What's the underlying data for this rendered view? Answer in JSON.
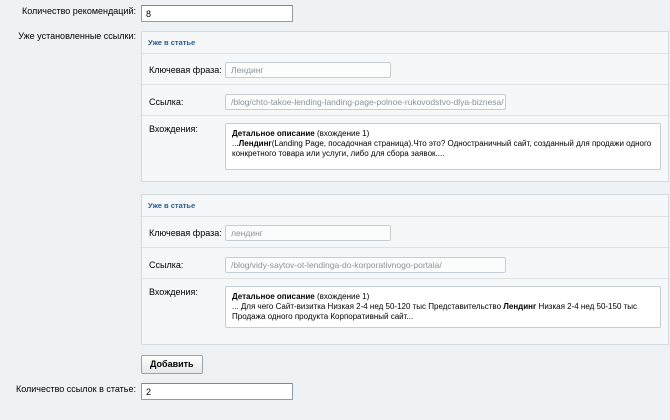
{
  "recommendations": {
    "label": "Количество рекомендаций:",
    "value": "8"
  },
  "installed_links": {
    "label": "Уже установленные ссылки:",
    "items": [
      {
        "title": "Уже в статье",
        "keyword_label": "Ключевая фраза:",
        "keyword": "Лендинг",
        "link_label": "Ссылка:",
        "link": "/blog/chto-takoe-lending-landing-page-polnoe-rukovodstvo-dlya-biznesa/",
        "occurrences_label": "Вхождения:",
        "occurrence_heading": "Детальное описание",
        "occurrence_count": "(вхождение 1)",
        "snippet_prefix": "...",
        "snippet_bold": "Лендинг",
        "snippet_rest": "(Landing Page, посадочная страница).Что это?  Одностраничный сайт, созданный для продажи одного конкретного товара или услуги, либо для сбора заявок...."
      },
      {
        "title": "Уже в статье",
        "keyword_label": "Ключевая фраза:",
        "keyword": "лендинг",
        "link_label": "Ссылка:",
        "link": "/blog/vidy-saytov-ot-lendinga-do-korporativnogo-portala/",
        "occurrences_label": "Вхождения:",
        "occurrence_heading": "Детальное описание",
        "occurrence_count": "(вхождение 1)",
        "snippet_prefix": "... Для чего  Сайт-визитка  Низкая  2-4 нед  50-120 тыс  Представительство ",
        "snippet_bold": "Лендинг",
        "snippet_rest": " Низкая  2-4 нед  50-150 тыс  Продажа одного продукта  Корпоративный сайт..."
      }
    ]
  },
  "add_button": {
    "label": "Добавить"
  },
  "links_in_article": {
    "label": "Количество ссылок в статье:",
    "value": "2"
  }
}
